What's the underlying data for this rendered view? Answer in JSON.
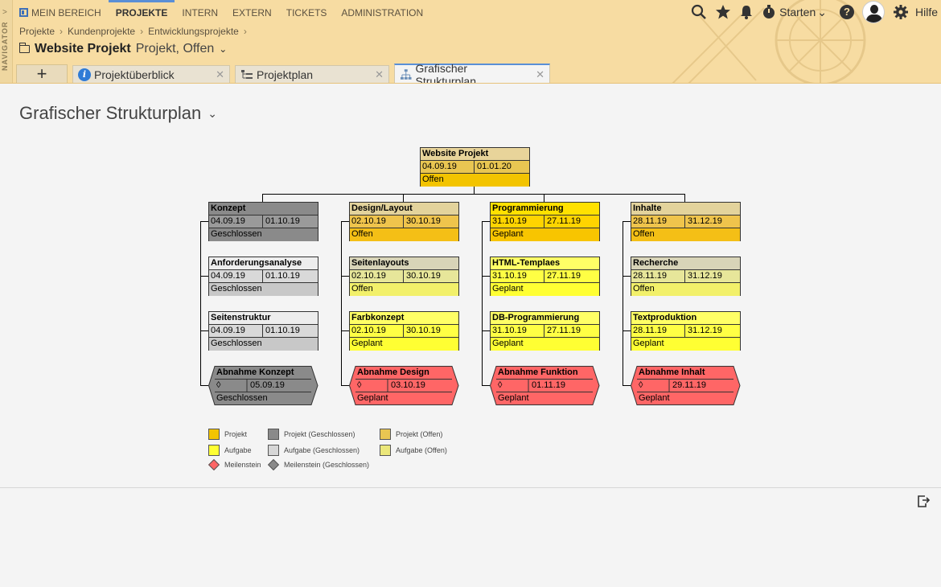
{
  "navigator": {
    "label": "NAVIGATOR"
  },
  "topnav": {
    "items": [
      {
        "label": "MEIN BEREICH"
      },
      {
        "label": "PROJEKTE"
      },
      {
        "label": "INTERN"
      },
      {
        "label": "EXTERN"
      },
      {
        "label": "TICKETS"
      },
      {
        "label": "ADMINISTRATION"
      }
    ],
    "active": "PROJEKTE"
  },
  "tools": {
    "starten_label": "Starten",
    "hilfe_label": "Hilfe"
  },
  "breadcrumb": [
    "Projekte",
    "Kundenprojekte",
    "Entwicklungsprojekte"
  ],
  "project": {
    "title": "Website Projekt",
    "subtitle": "Projekt, Offen"
  },
  "tabs": [
    {
      "label": "Projektüberblick"
    },
    {
      "label": "Projektplan"
    },
    {
      "label": "Grafischer Strukturplan"
    }
  ],
  "page": {
    "heading": "Grafischer Strukturplan"
  },
  "wbs": {
    "root": {
      "title": "Website Projekt",
      "start": "04.09.19",
      "end": "01.01.20",
      "status": "Offen"
    },
    "columns": [
      {
        "items": [
          {
            "title": "Konzept",
            "start": "04.09.19",
            "end": "01.10.19",
            "status": "Geschlossen"
          },
          {
            "title": "Anforderungsanalyse",
            "start": "04.09.19",
            "end": "01.10.19",
            "status": "Geschlossen"
          },
          {
            "title": "Seitenstruktur",
            "start": "04.09.19",
            "end": "01.10.19",
            "status": "Geschlossen"
          },
          {
            "title": "Abnahme Konzept",
            "symbol": "◊",
            "date": "05.09.19",
            "status": "Geschlossen"
          }
        ]
      },
      {
        "items": [
          {
            "title": "Design/Layout",
            "start": "02.10.19",
            "end": "30.10.19",
            "status": "Offen"
          },
          {
            "title": "Seitenlayouts",
            "start": "02.10.19",
            "end": "30.10.19",
            "status": "Offen"
          },
          {
            "title": "Farbkonzept",
            "start": "02.10.19",
            "end": "30.10.19",
            "status": "Geplant"
          },
          {
            "title": "Abnahme Design",
            "symbol": "◊",
            "date": "03.10.19",
            "status": "Geplant"
          }
        ]
      },
      {
        "items": [
          {
            "title": "Programmierung",
            "start": "31.10.19",
            "end": "27.11.19",
            "status": "Geplant"
          },
          {
            "title": "HTML-Templaes",
            "start": "31.10.19",
            "end": "27.11.19",
            "status": "Geplant"
          },
          {
            "title": "DB-Programmierung",
            "start": "31.10.19",
            "end": "27.11.19",
            "status": "Geplant"
          },
          {
            "title": "Abnahme Funktion",
            "symbol": "◊",
            "date": "01.11.19",
            "status": "Geplant"
          }
        ]
      },
      {
        "items": [
          {
            "title": "Inhalte",
            "start": "28.11.19",
            "end": "31.12.19",
            "status": "Offen"
          },
          {
            "title": "Recherche",
            "start": "28.11.19",
            "end": "31.12.19",
            "status": "Offen"
          },
          {
            "title": "Textproduktion",
            "start": "28.11.19",
            "end": "31.12.19",
            "status": "Geplant"
          },
          {
            "title": "Abnahme Inhalt",
            "symbol": "◊",
            "date": "29.11.19",
            "status": "Geplant"
          }
        ]
      }
    ]
  },
  "legend": {
    "projekt": "Projekt",
    "projekt_geschlossen": "Projekt (Geschlossen)",
    "projekt_offen": "Projekt (Offen)",
    "aufgabe": "Aufgabe",
    "aufgabe_geschlossen": "Aufgabe (Geschlossen)",
    "aufgabe_offen": "Aufgabe (Offen)",
    "meilenstein": "Meilenstein",
    "meilenstein_geschlossen": "Meilenstein (Geschlossen)"
  },
  "colors": {
    "projekt": "#f3c400",
    "projekt_geschlossen": "#8a8a8a",
    "projekt_offen": "#e9c652",
    "aufgabe": "#ffff33",
    "aufgabe_geschlossen": "#d6d6d6",
    "aufgabe_offen": "#ebe77a",
    "meilenstein": "#ff6666",
    "meilenstein_geschlossen": "#8a8a8a",
    "accent": "#5a8fd6",
    "header_bg": "#f7dca2"
  }
}
